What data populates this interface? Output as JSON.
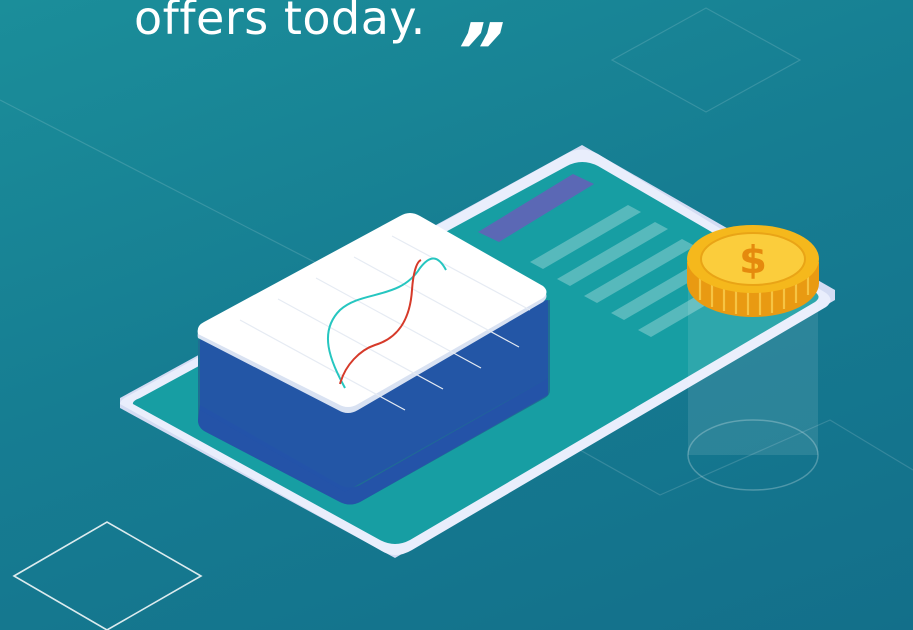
{
  "hero": {
    "quote_text": "offers today.",
    "close_quote": "”"
  },
  "icons": {
    "coin": "dollar-coin-icon",
    "device": "smartphone-illustration",
    "chart_card": "line-chart-card"
  },
  "coin": {
    "symbol": "$"
  },
  "colors": {
    "background": "#167d92",
    "phone_body": "#e9eefc",
    "phone_screen": "#179ea3",
    "card_shadow": "#2453a8",
    "coin_gold": "#f5b81c",
    "line_teal": "#26c6c0",
    "line_red": "#d63a2a"
  }
}
